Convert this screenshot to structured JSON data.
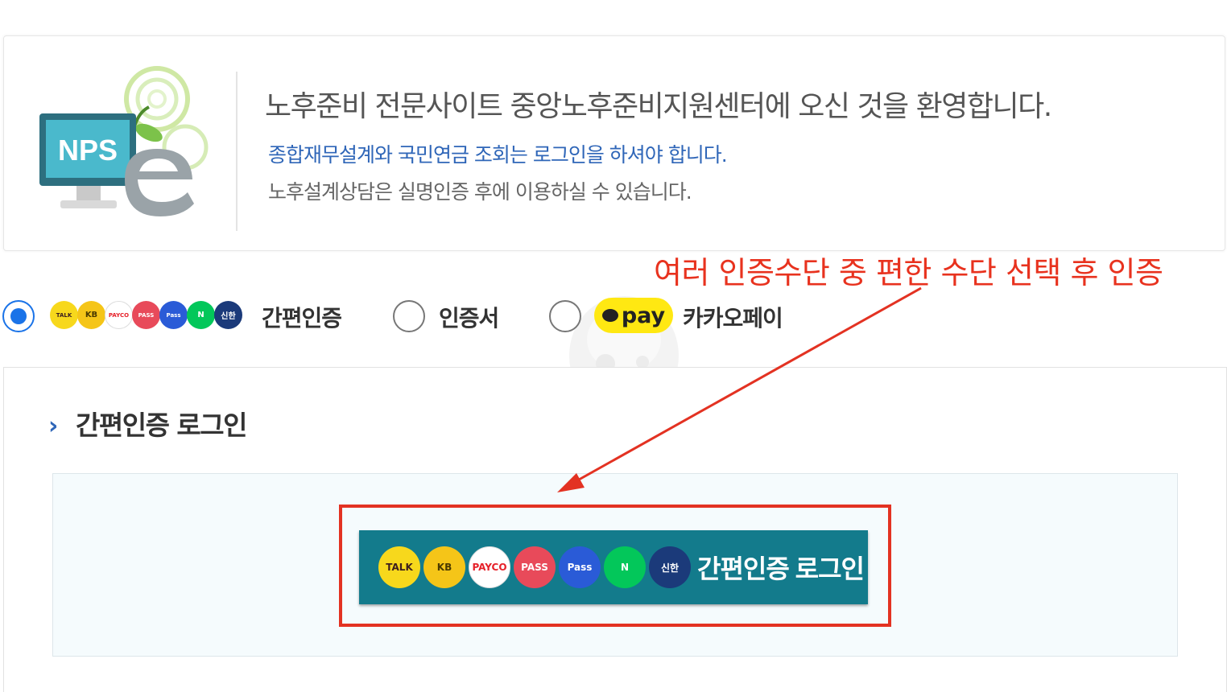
{
  "welcome": {
    "logo_text": "NPS",
    "title": "노후준비 전문사이트 중앙노후준비지원센터에 오신 것을 환영합니다.",
    "notice": "종합재무설계와 국민연금 조회는 로그인을 하셔야 합니다.",
    "info": "노후설계상담은 실명인증 후에 이용하실 수 있습니다."
  },
  "annotation": "여러 인증수단 중 편한 수단 선택 후 인증",
  "auth_options": [
    {
      "label": "간편인증",
      "selected": true
    },
    {
      "label": "인증서",
      "selected": false
    },
    {
      "label": "카카오페이",
      "selected": false,
      "badge": "pay"
    }
  ],
  "providers": [
    {
      "name": "kakaotalk-icon",
      "text": "TALK",
      "color": "#f7d81c",
      "text_color": "#3c1e1e"
    },
    {
      "name": "kb-icon",
      "text": "KB",
      "color": "#f5c518",
      "text_color": "#4a3a00"
    },
    {
      "name": "payco-icon",
      "text": "PAYCO",
      "color": "#ffffff",
      "text_color": "#e6212a"
    },
    {
      "name": "pass-icon",
      "text": "PASS",
      "color": "#e84a5a",
      "text_color": "#ffffff"
    },
    {
      "name": "samsung-pass-icon",
      "text": "Pass",
      "color": "#2a5bd7",
      "text_color": "#ffffff"
    },
    {
      "name": "naver-icon",
      "text": "N",
      "color": "#03c75a",
      "text_color": "#ffffff"
    },
    {
      "name": "shinhan-icon",
      "text": "신한",
      "color": "#1b3a7a",
      "text_color": "#ffffff"
    }
  ],
  "section": {
    "title": "간편인증 로그인"
  },
  "login_button": {
    "label": "간편인증 로그인"
  },
  "colors": {
    "accent_blue": "#1a73e8",
    "button_teal": "#137b8c",
    "annotation_red": "#e33222"
  }
}
